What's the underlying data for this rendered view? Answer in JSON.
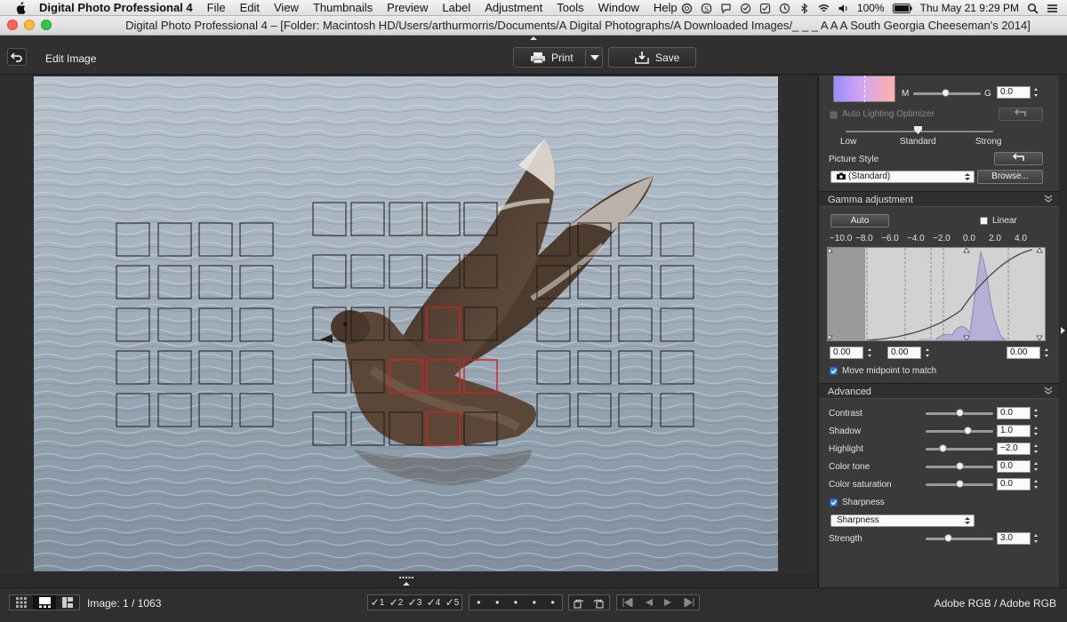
{
  "menubar": {
    "app_name": "Digital Photo Professional 4",
    "items": [
      "File",
      "Edit",
      "View",
      "Thumbnails",
      "Preview",
      "Label",
      "Adjustment",
      "Tools",
      "Window",
      "Help"
    ],
    "battery": "100%",
    "clock": "Thu May 21  9:29 PM"
  },
  "window": {
    "title": "Digital Photo Professional 4 – [Folder: Macintosh HD/Users/arthurmorris/Documents/A Digital Photographs/A Downloaded Images/_ _ _ A A A South Georgia Cheeseman's 2014]"
  },
  "toolbar": {
    "title": "Edit Image",
    "print_label": "Print",
    "save_label": "Save"
  },
  "panel": {
    "wb": {
      "m_label": "M",
      "g_label": "G",
      "g_value": "0.0"
    },
    "alo": {
      "label": "Auto Lighting Optimizer",
      "low": "Low",
      "standard": "Standard",
      "strong": "Strong"
    },
    "picture_style": {
      "label": "Picture Style",
      "selected": "(Standard)",
      "browse": "Browse..."
    },
    "gamma": {
      "header": "Gamma adjustment",
      "auto": "Auto",
      "linear": "Linear",
      "ticks": [
        "−10.0",
        "−8.0",
        "−6.0",
        "−4.0",
        "−2.0",
        "0.0",
        "2.0",
        "4.0"
      ],
      "left_value": "0.00",
      "mid_value": "0.00",
      "right_value": "0.00",
      "midpoint_label": "Move midpoint to match"
    },
    "advanced": {
      "header": "Advanced",
      "rows": [
        {
          "label": "Contrast",
          "value": "0.0",
          "level": 0.5
        },
        {
          "label": "Shadow",
          "value": "1.0",
          "level": 0.62
        },
        {
          "label": "Highlight",
          "value": "−2.0",
          "level": 0.25
        },
        {
          "label": "Color tone",
          "value": "0.0",
          "level": 0.5
        },
        {
          "label": "Color saturation",
          "value": "0.0",
          "level": 0.5
        }
      ],
      "sharpness_check": "Sharpness",
      "sharpness_select": "Sharpness",
      "strength_label": "Strength",
      "strength_value": "3.0"
    }
  },
  "bottombar": {
    "image_counter": "Image: 1 / 1063",
    "ratings": [
      "1",
      "2",
      "3",
      "4",
      "5"
    ],
    "color_space": "Adobe RGB / Adobe RGB"
  },
  "colors": {
    "panel_bg": "#3a3a3a",
    "af_point_active": "#d42020",
    "af_point": "#1a1a1a",
    "water": "#8f9fae"
  }
}
